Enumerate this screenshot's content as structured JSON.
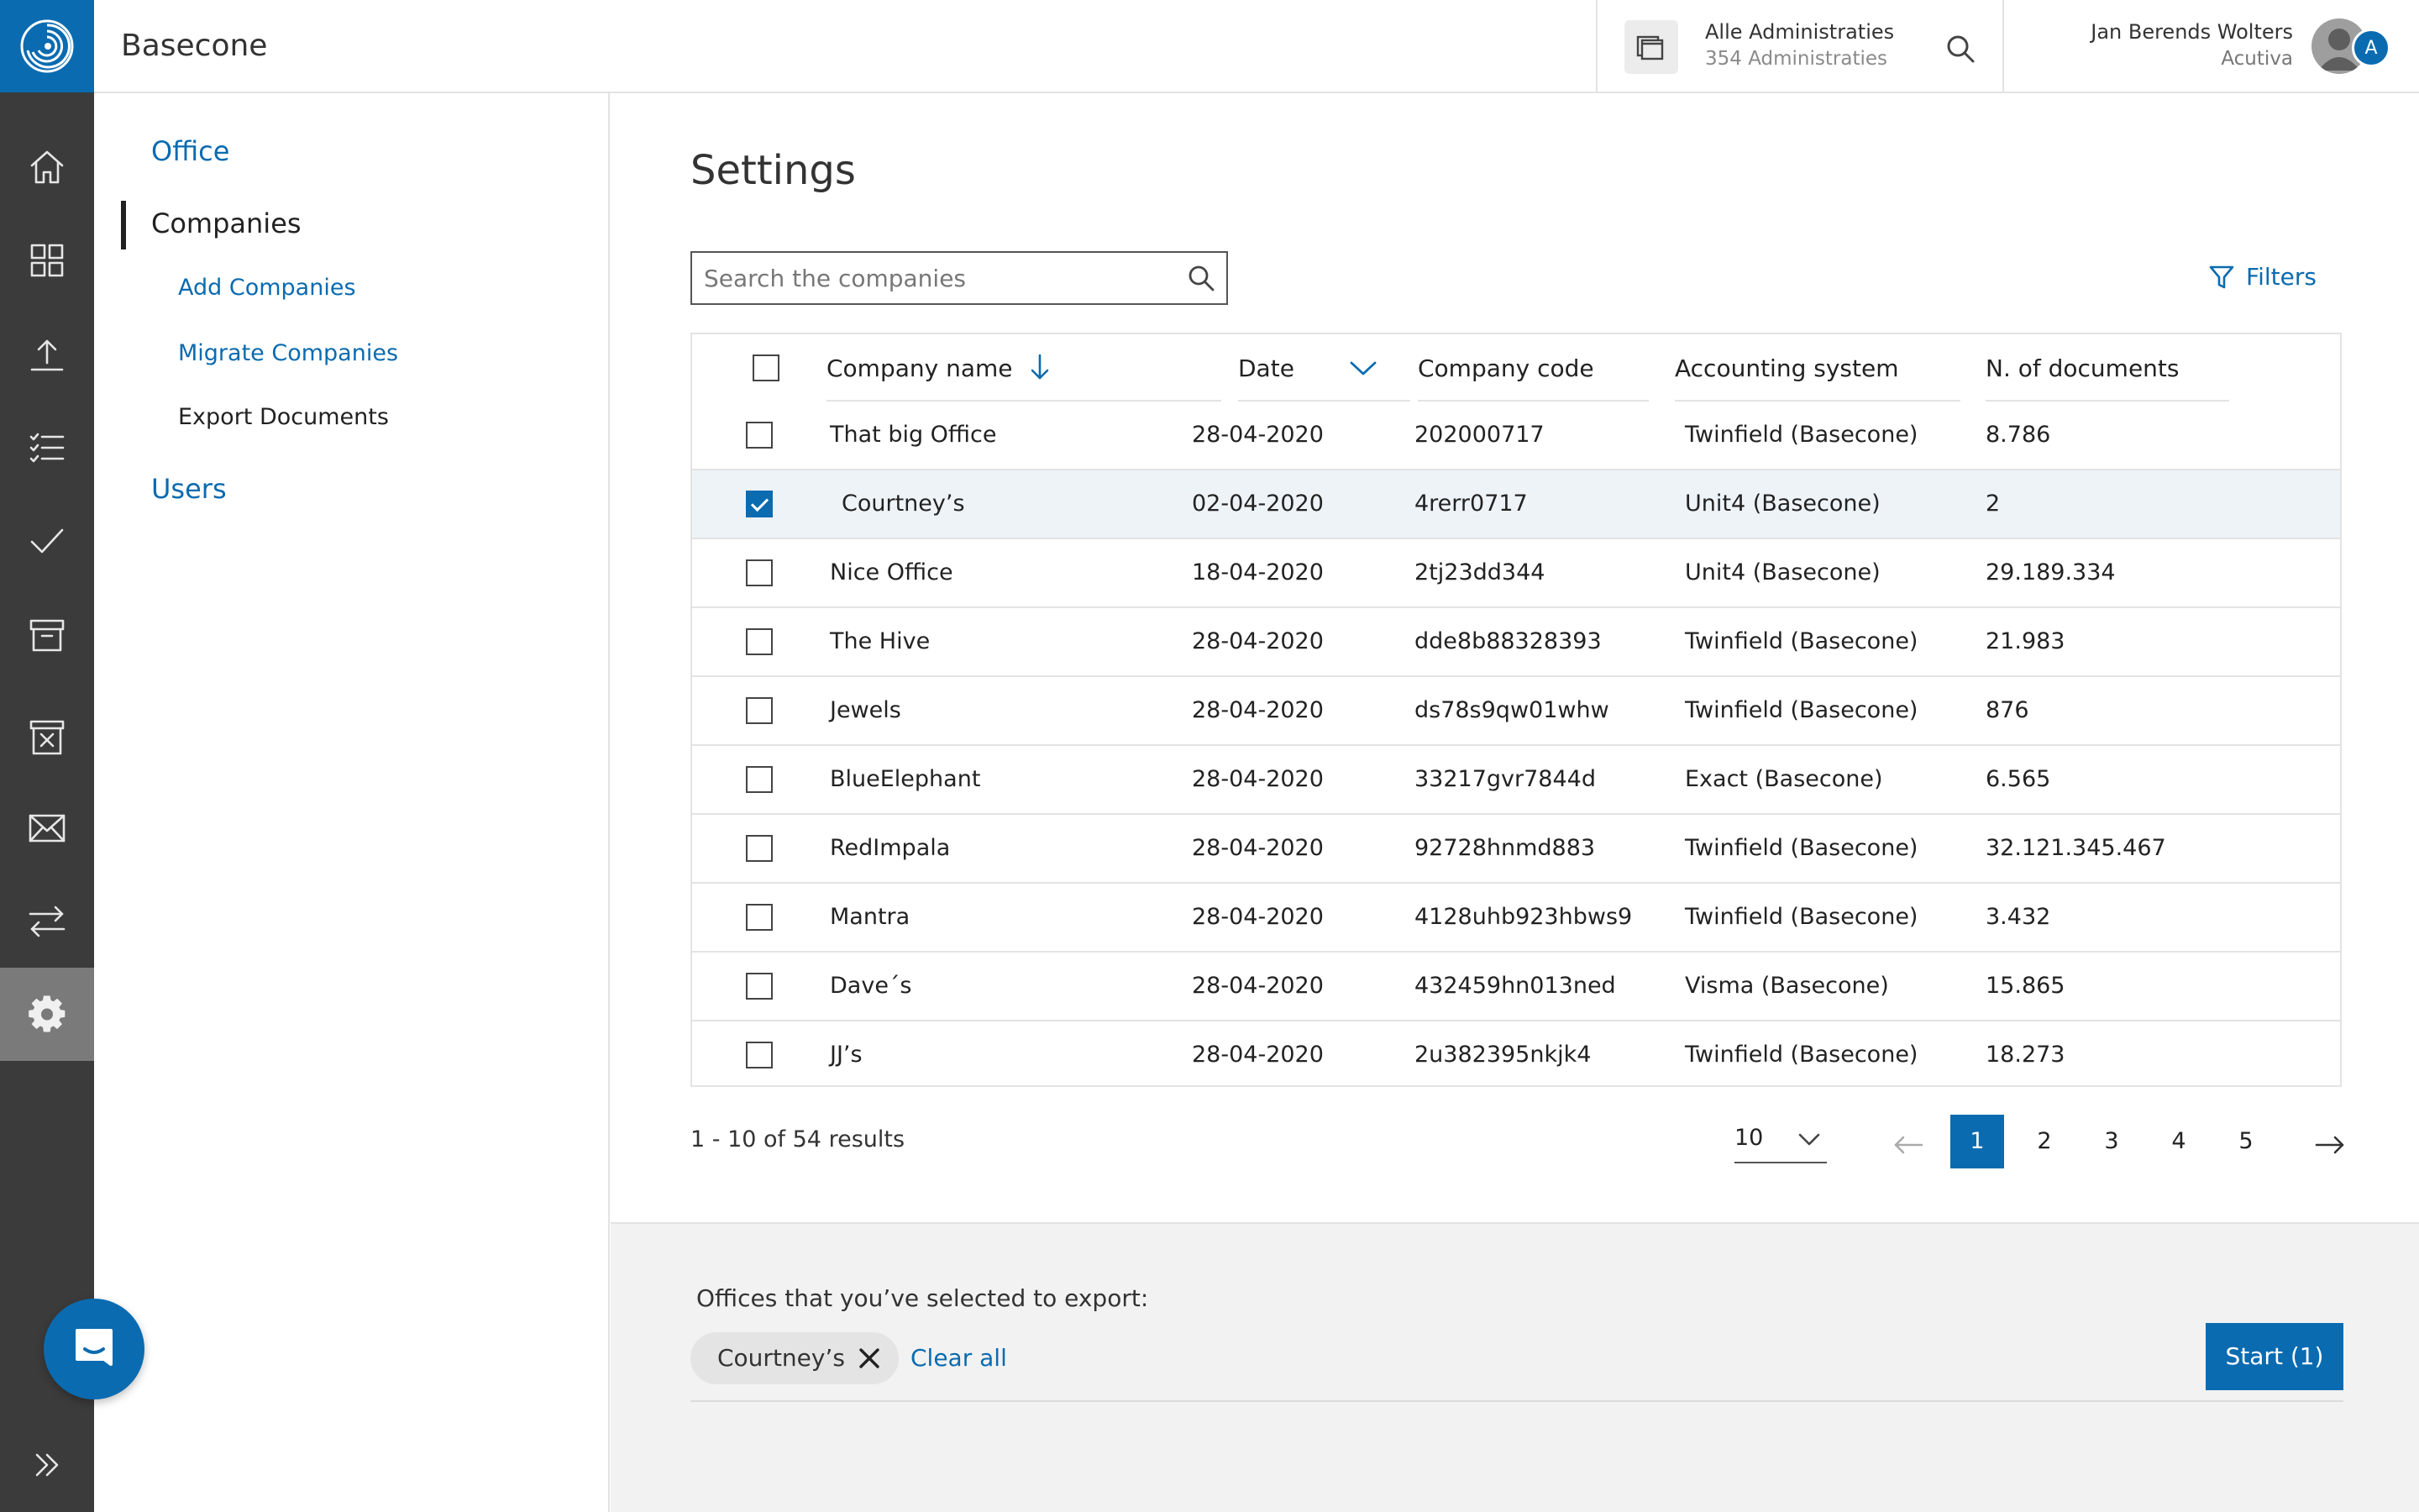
{
  "app": {
    "title": "Basecone"
  },
  "topbar": {
    "admin_name": "Alle Administraties",
    "admin_count": "354 Administraties",
    "user_name": "Jan Berends Wolters",
    "user_org": "Acutiva",
    "avatar_initial": "A"
  },
  "rail": {
    "items": [
      "home-icon",
      "dashboard-icon",
      "upload-icon",
      "checklist-icon",
      "check-icon",
      "archive-icon",
      "archive-remove-icon",
      "mail-icon",
      "transfer-icon",
      "gear-icon"
    ],
    "active": "gear-icon"
  },
  "subnav": {
    "office": "Office",
    "companies": "Companies",
    "add_companies": "Add Companies",
    "migrate_companies": "Migrate Companies",
    "export_documents": "Export Documents",
    "users": "Users"
  },
  "main": {
    "title": "Settings",
    "search_placeholder": "Search the companies",
    "filters_label": "Filters"
  },
  "table": {
    "headers": {
      "company": "Company name",
      "date": "Date",
      "code": "Company code",
      "system": "Accounting system",
      "docs": "N. of documents"
    },
    "rows": [
      {
        "name": "That big Office",
        "date": "28-04-2020",
        "code": "202000717",
        "system": "Twinfield (Basecone)",
        "docs": "8.786"
      },
      {
        "name": "Courtney’s",
        "date": "02-04-2020",
        "code": "4rerr0717",
        "system": "Unit4 (Basecone)",
        "docs": "2"
      },
      {
        "name": "Nice Office",
        "date": "18-04-2020",
        "code": "2tj23dd344",
        "system": "Unit4  (Basecone)",
        "docs": "29.189.334"
      },
      {
        "name": "The Hive",
        "date": "28-04-2020",
        "code": "dde8b88328393",
        "system": "Twinfield (Basecone)",
        "docs": "21.983"
      },
      {
        "name": "Jewels",
        "date": "28-04-2020",
        "code": "ds78s9qw01whw",
        "system": "Twinfield (Basecone)",
        "docs": "876"
      },
      {
        "name": "BlueElephant",
        "date": "28-04-2020",
        "code": "33217gvr7844d",
        "system": "Exact (Basecone)",
        "docs": "6.565"
      },
      {
        "name": "RedImpala",
        "date": "28-04-2020",
        "code": "92728hnmd883",
        "system": "Twinfield (Basecone)",
        "docs": "32.121.345.467"
      },
      {
        "name": "Mantra",
        "date": "28-04-2020",
        "code": "4128uhb923hbws9",
        "system": "Twinfield (Basecone)",
        "docs": "3.432"
      },
      {
        "name": "Dave´s",
        "date": "28-04-2020",
        "code": "432459hn013ned",
        "system": "Visma (Basecone)",
        "docs": "15.865"
      },
      {
        "name": "JJ’s",
        "date": "28-04-2020",
        "code": "2u382395nkjk4",
        "system": "Twinfield (Basecone)",
        "docs": "18.273"
      }
    ]
  },
  "pagination": {
    "results": "1 - 10 of 54 results",
    "per_page": "10",
    "pages": [
      "1",
      "2",
      "3",
      "4",
      "5"
    ],
    "current": "1"
  },
  "export": {
    "label": "Offices that you’ve selected to export:",
    "chip": "Courtney’s",
    "clear_all": "Clear all",
    "start": "Start (1)"
  },
  "colors": {
    "brand": "#0a6bb0",
    "rail": "#3b3b3b",
    "rail_active": "#7a7a7a"
  }
}
